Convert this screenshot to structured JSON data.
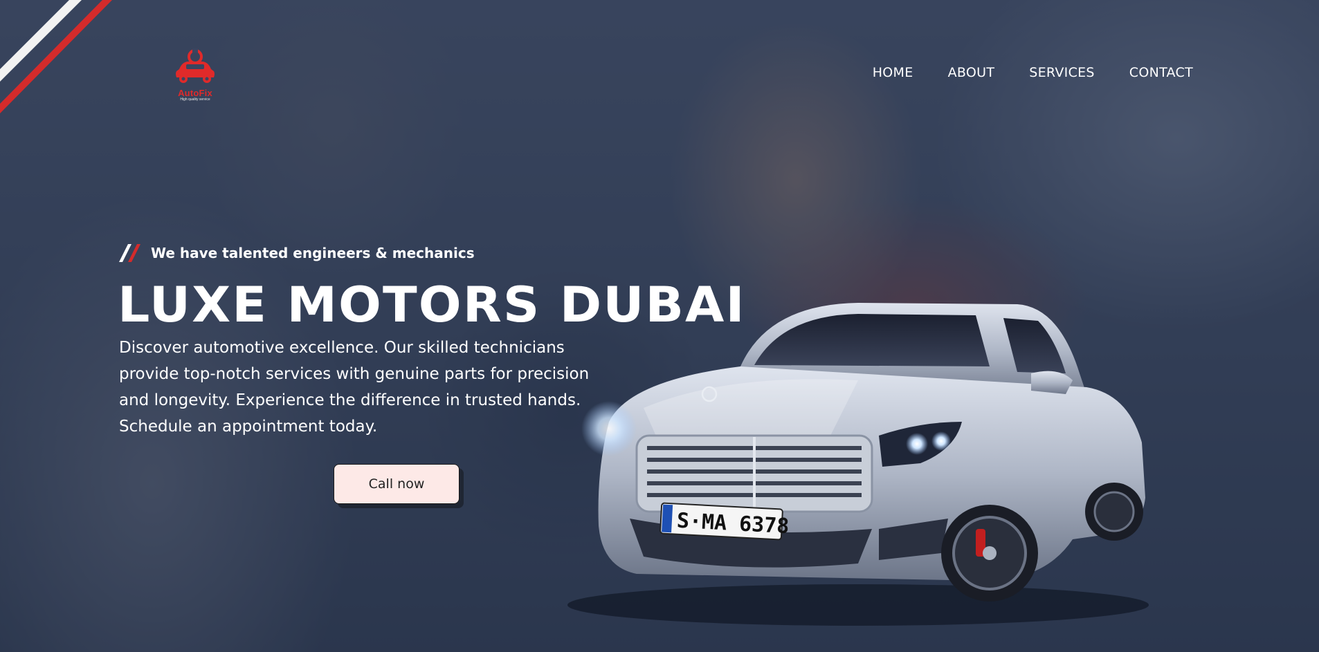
{
  "brand": {
    "name": "AutoFix",
    "tagline": "High quality service",
    "color": "#e02a2a"
  },
  "nav": {
    "items": [
      {
        "label": "HOME"
      },
      {
        "label": "ABOUT"
      },
      {
        "label": "SERVICES"
      },
      {
        "label": "CONTACT"
      }
    ]
  },
  "hero": {
    "tagline": "We have talented engineers & mechanics",
    "title": "LUXE MOTORS DUBAI",
    "description": "Discover automotive excellence. Our skilled technicians provide top-notch services with genuine parts for precision and longevity. Experience the difference in trusted hands. Schedule an appointment today.",
    "cta_label": "Call now"
  },
  "car": {
    "plate": "S·MA 6378"
  },
  "colors": {
    "accent": "#e02a2a",
    "overlay": "#283450",
    "button_bg": "#fde9e7"
  },
  "icons": {
    "logo": "car-wrench-icon",
    "tagline_mark": "double-slash-icon",
    "corner": "corner-stripes"
  }
}
